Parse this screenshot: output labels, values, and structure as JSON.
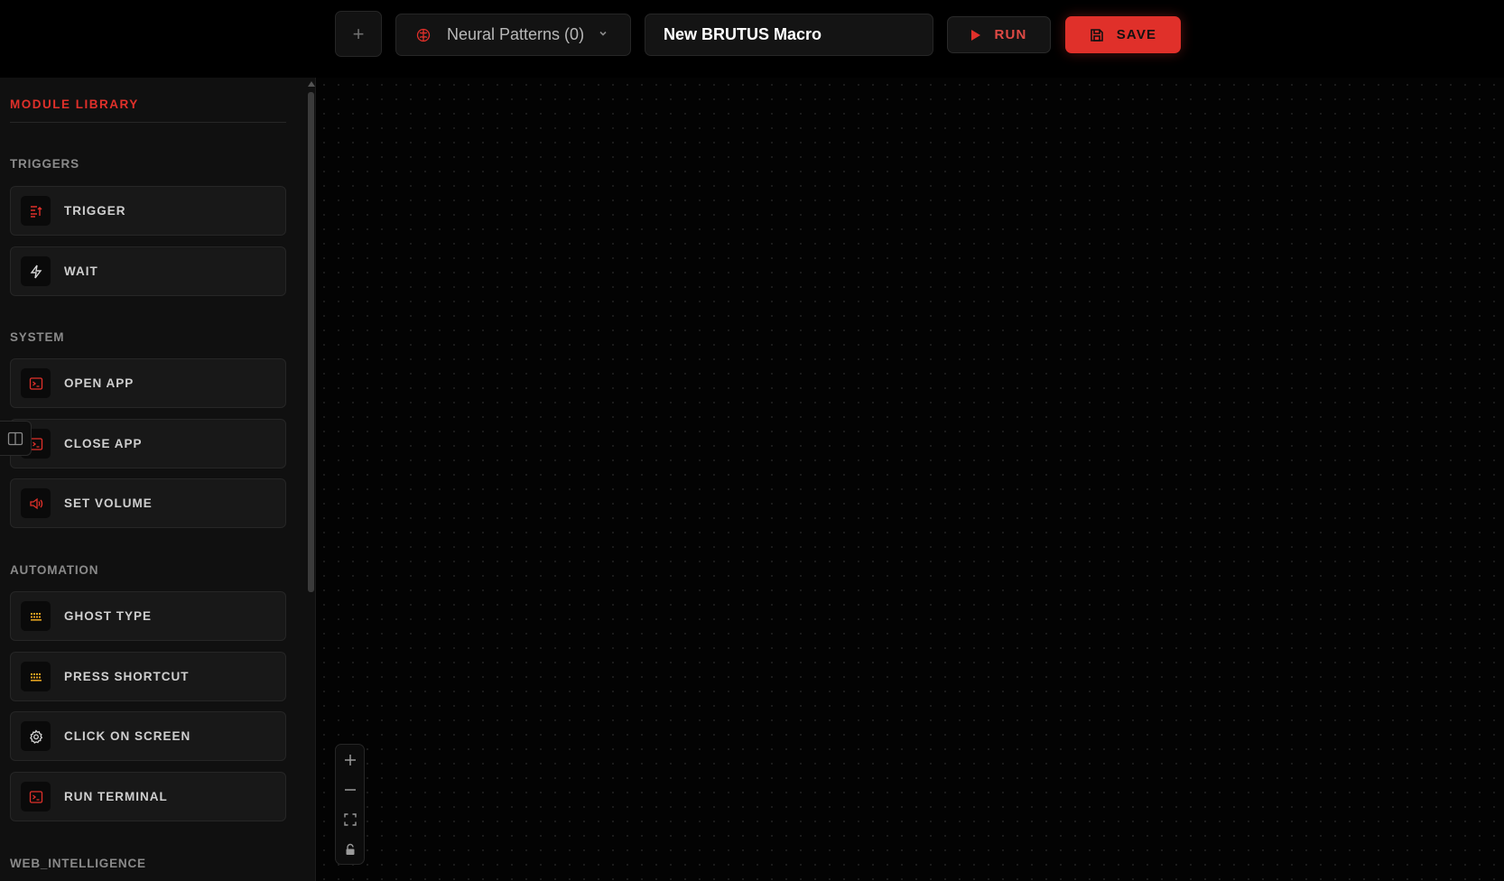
{
  "toolbar": {
    "add_label": "+",
    "patterns_label": "Neural Patterns (0)",
    "macro_name": "New BRUTUS Macro",
    "run_label": "RUN",
    "save_label": "SAVE"
  },
  "sidebar": {
    "title": "MODULE LIBRARY",
    "sections": [
      {
        "label": "TRIGGERS"
      },
      {
        "label": "SYSTEM"
      },
      {
        "label": "AUTOMATION"
      },
      {
        "label": "WEB_INTELLIGENCE"
      }
    ],
    "items": [
      {
        "label": "TRIGGER",
        "icon": "list-start-icon"
      },
      {
        "label": "WAIT",
        "icon": "lightning-icon"
      },
      {
        "label": "OPEN APP",
        "icon": "terminal-icon"
      },
      {
        "label": "CLOSE APP",
        "icon": "terminal-icon"
      },
      {
        "label": "SET VOLUME",
        "icon": "speaker-icon"
      },
      {
        "label": "GHOST TYPE",
        "icon": "keyboard-icon"
      },
      {
        "label": "PRESS SHORTCUT",
        "icon": "keyboard-icon"
      },
      {
        "label": "CLICK ON SCREEN",
        "icon": "gear-icon"
      },
      {
        "label": "RUN TERMINAL",
        "icon": "terminal-icon"
      }
    ]
  },
  "canvas_controls": [
    "zoom-in-icon",
    "zoom-out-icon",
    "fit-view-icon",
    "lock-icon"
  ],
  "colors": {
    "accent": "#e0302a",
    "background": "#020202",
    "panel": "#101010",
    "keyboard_icon": "#e0a020"
  }
}
